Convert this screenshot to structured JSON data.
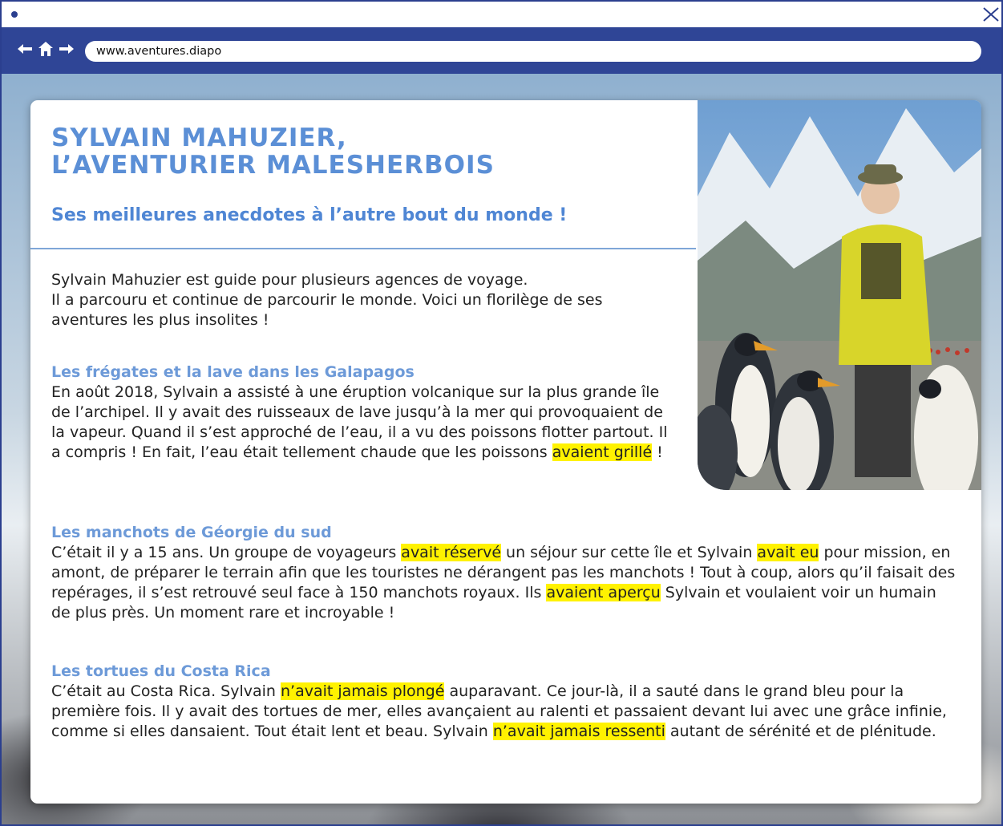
{
  "browser": {
    "url": "www.aventures.diapo",
    "nav_icons": [
      "arrow-left-icon",
      "home-icon",
      "arrow-right-icon"
    ]
  },
  "article": {
    "title_line1": "Sylvain Mahuzier,",
    "title_line2": "l’aventurier malesherbois",
    "subtitle": "Ses meilleures anecdotes à l’autre bout du monde !",
    "intro_line1": "Sylvain Mahuzier est guide pour plusieurs agences de voyage.",
    "intro_line2": "Il a parcouru et continue de parcourir le monde. Voici un florilège de ses aventures les plus insolites !",
    "sections": [
      {
        "heading": "Les frégates et la lave dans les Galapagos",
        "text_a": "En août 2018, Sylvain a assisté à une éruption volcanique sur la plus grande île de l’archipel. Il y avait des ruisseaux de lave jusqu’à la mer qui provoquaient de la vapeur. Quand il s’est approché de l’eau, il a vu des poissons flotter partout. Il a compris ! En fait, l’eau était tellement chaude que les poissons ",
        "hl_1": "avaient grillé",
        "text_b": " !"
      },
      {
        "heading": "Les manchots de Géorgie du sud",
        "text_a": "C’était il y a 15 ans. Un groupe de voyageurs ",
        "hl_1": "avait réservé",
        "text_b": " un séjour sur cette île et Sylvain ",
        "hl_2": "avait eu",
        "text_c": " pour mission, en amont, de préparer le terrain afin que les touristes ne dérangent pas les manchots ! Tout à coup, alors qu’il faisait des repérages, il s’est retrouvé seul face à 150 manchots royaux. Ils ",
        "hl_3": "avaient aperçu",
        "text_d": " Sylvain et voulaient voir un humain de plus près. Un moment rare et incroyable !"
      },
      {
        "heading": "Les tortues du Costa Rica",
        "text_a": "C’était au Costa Rica. Sylvain ",
        "hl_1": "n’avait jamais plongé",
        "text_b": " auparavant. Ce jour-là, il a sauté dans le grand bleu pour la première fois. Il y avait des tortues de mer, elles avançaient au ralenti et passaient devant lui avec une grâce infinie, comme si elles dansaient. Tout était lent et beau. Sylvain ",
        "hl_2": "n’avait jamais ressenti",
        "text_c": " autant de sérénité et de plénitude."
      }
    ]
  },
  "colors": {
    "nav_bar": "#2f4596",
    "title": "#5b8fd6",
    "section_heading": "#6d9ad8",
    "highlight": "#fff200"
  }
}
